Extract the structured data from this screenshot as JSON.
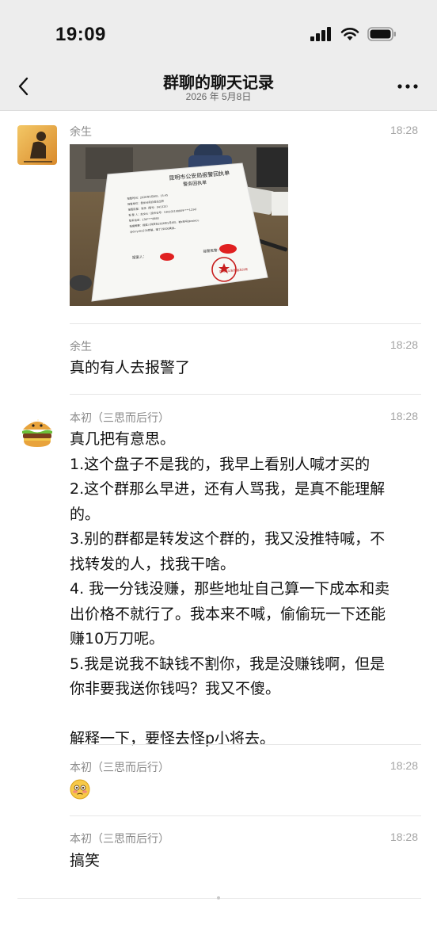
{
  "status_bar": {
    "time": "19:09"
  },
  "nav": {
    "title": "群聊的聊天记录",
    "subtitle": "2026 年 5月8日"
  },
  "photo_text": {
    "doc_title": "昆明市公安局报警回执单",
    "doc_subtitle": "警务回执单",
    "doc_lines": [
      "报警时间：2026年5月8日，15:45",
      "接警单位：盘龙分局白塔派出所",
      "接警民警：张伟（警号：041325）",
      "报 警 人：赵女士（身份证号：530102198809****1234）",
      "联系电话：138****8888",
      "报案概要：报案人称其在2026年5月8日，被x账号@eaiecu",
      "@dcryds1234欺骗，骗了19000美金。"
    ],
    "sign_left": "报案人：",
    "sign_right": "接警民警：",
    "seal": "昆明市公安局盘龙分局"
  },
  "messages": [
    {
      "sender": "余生",
      "time": "18:28",
      "type": "image"
    },
    {
      "sender": "余生",
      "time": "18:28",
      "lines": [
        "真的有人去报警了"
      ]
    },
    {
      "sender": "本初（三思而后行）",
      "time": "18:28",
      "lines": [
        "真几把有意思。",
        "1.这个盘子不是我的，我早上看别人喊才买的",
        "2.这个群那么早进，还有人骂我，是真不能理解",
        "的。",
        "3.别的群都是转发这个群的，我又没推特喊，不",
        "找转发的人，找我干啥。",
        "4. 我一分钱没赚，那些地址自己算一下成本和卖",
        "出价格不就行了。我本来不喊，偷偷玩一下还能",
        "赚10万刀呢。",
        "5.我是说我不缺钱不割你，我是没赚钱啊，但是",
        "你非要我送你钱吗？我又不傻。",
        "",
        "解释一下，要怪去怪p小将去。"
      ]
    },
    {
      "sender": "本初（三思而后行）",
      "time": "18:28",
      "emoji": "😳"
    },
    {
      "sender": "本初（三思而后行）",
      "time": "18:28",
      "lines": [
        "搞笑"
      ]
    }
  ]
}
